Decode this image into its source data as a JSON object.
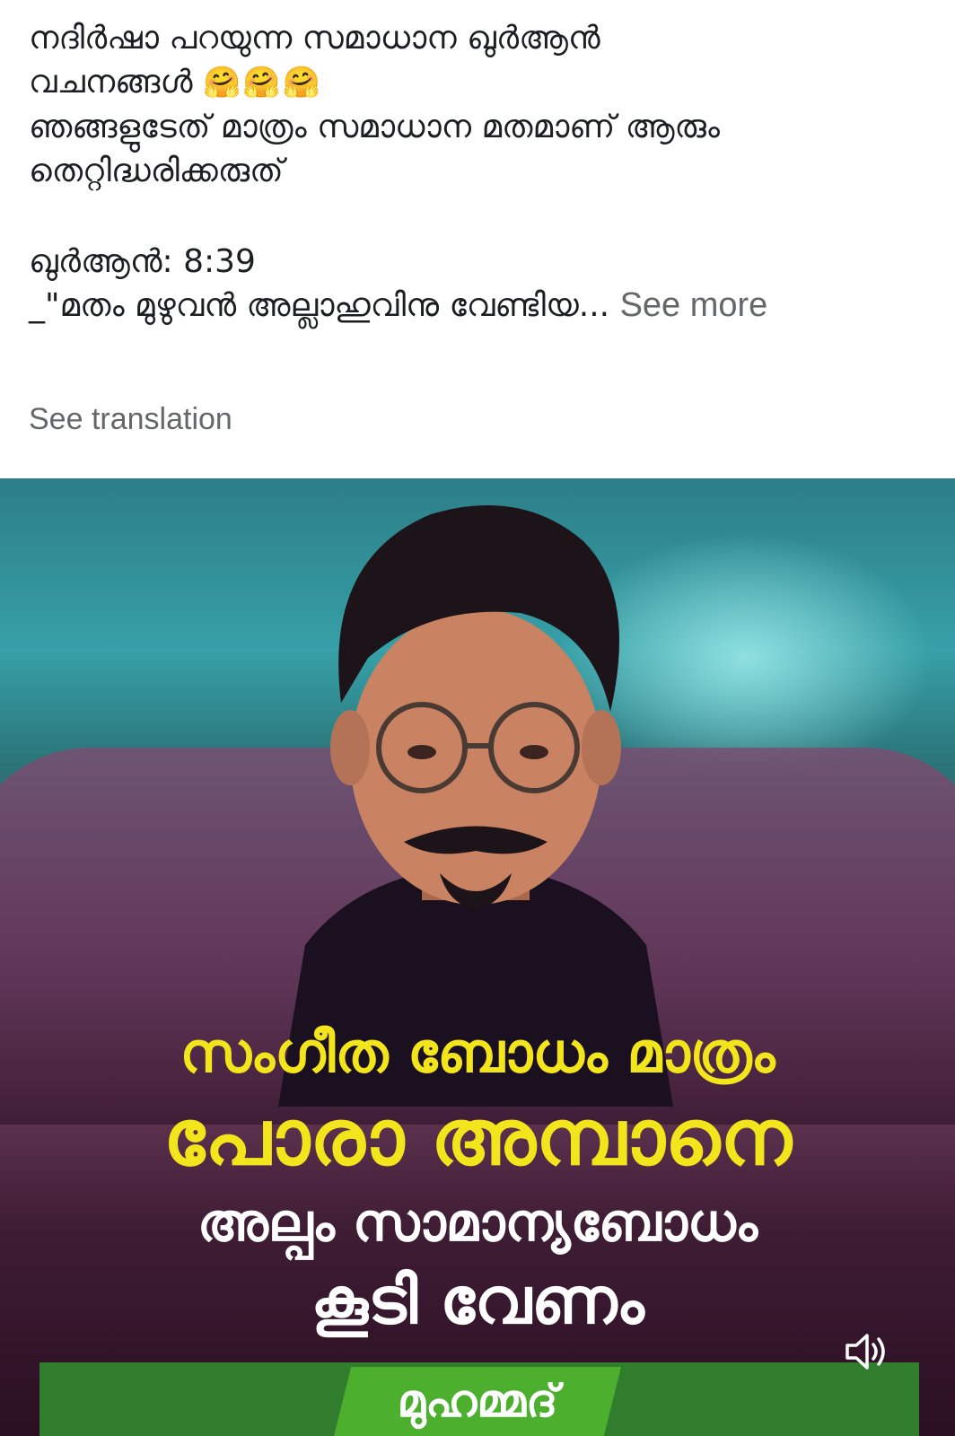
{
  "post": {
    "lines": [
      "നദിർഷാ പറയുന്ന സമാധാന ഖുർആൻ",
      "വചനങ്ങൾ",
      "ഞങ്ങളുടേത് മാത്രം സമാധാന മതമാണ് ആരും",
      "തെറ്റിദ്ധരിക്കരുത്",
      "ഖുർആൻ: 8:39",
      "_\"മതം മുഴുവൻ അല്ലാഹുവിനു വേണ്ടിയ..."
    ],
    "emoji": "🤗🤗🤗",
    "see_more": "See more",
    "see_translation": "See translation"
  },
  "media": {
    "headline_1": "സംഗീത ബോധം മാത്രം",
    "headline_2": "പോരാ അമ്പാനെ",
    "headline_3": "അല്പം സാമാന്യബോധം",
    "headline_4": "കൂടി വേണം",
    "name_tag": "മുഹമ്മദ്",
    "sound_icon": "speaker-icon"
  }
}
